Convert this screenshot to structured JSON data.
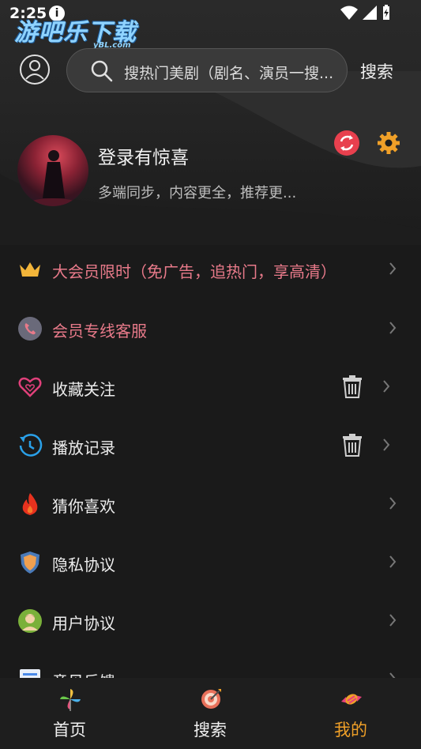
{
  "status_bar": {
    "time": "2:25",
    "info_glyph": "i"
  },
  "watermark": {
    "text": "游吧乐下载",
    "sub": "yBL.com"
  },
  "header": {
    "search_placeholder": "搜热门美剧（剧名、演员一搜...",
    "search_button": "搜索"
  },
  "profile": {
    "title": "登录有惊喜",
    "subtitle": "多端同步，内容更全，推荐更..."
  },
  "menu": [
    {
      "label": "大会员限时（免广告，追热门，享高清）",
      "icon": "crown-icon",
      "accent": "#e87a8a"
    },
    {
      "label": "会员专线客服",
      "icon": "phone-icon",
      "accent": "#e87a8a"
    },
    {
      "label": "收藏关注",
      "icon": "heart-icon"
    },
    {
      "label": "播放记录",
      "icon": "history-icon"
    },
    {
      "label": "猜你喜欢",
      "icon": "flame-icon"
    },
    {
      "label": "隐私协议",
      "icon": "shield-icon"
    },
    {
      "label": "用户协议",
      "icon": "user-agreement-icon"
    },
    {
      "label": "意见反馈",
      "icon": "feedback-icon"
    }
  ],
  "bottom_nav": [
    {
      "label": "首页",
      "icon": "pinwheel-icon",
      "active": false
    },
    {
      "label": "搜索",
      "icon": "target-icon",
      "active": false
    },
    {
      "label": "我的",
      "icon": "candy-icon",
      "active": true
    }
  ],
  "colors": {
    "accent_orange": "#f0a028",
    "accent_pink": "#e87a8a",
    "sync_red": "#e8404e"
  }
}
